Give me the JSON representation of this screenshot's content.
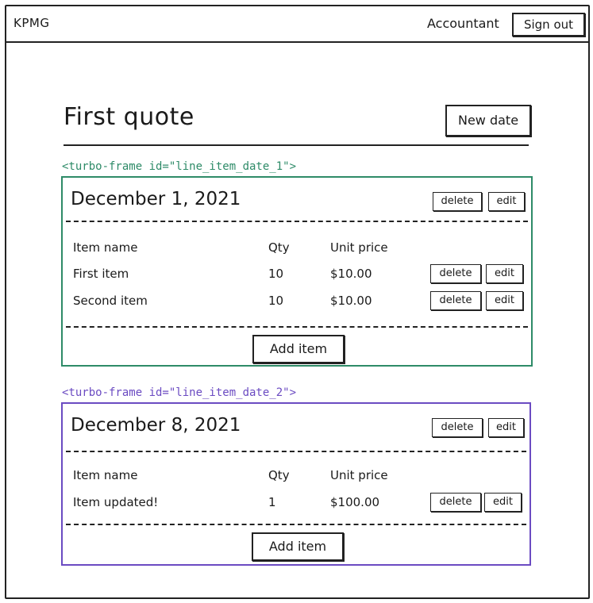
{
  "navbar": {
    "brand": "KPMG",
    "user": "Accountant",
    "sign_out": "Sign out"
  },
  "quote": {
    "title": "First quote",
    "new_date": "New date"
  },
  "frames": [
    {
      "label": "<turbo-frame id=\"line_item_date_1\">",
      "color": "#2e8b68",
      "date": "December 1, 2021",
      "delete": "delete",
      "edit": "edit",
      "headers": {
        "name": "Item name",
        "qty": "Qty",
        "price": "Unit price"
      },
      "items": [
        {
          "name": "First item",
          "qty": "10",
          "price": "$10.00",
          "delete": "delete",
          "edit": "edit"
        },
        {
          "name": "Second item",
          "qty": "10",
          "price": "$10.00",
          "delete": "delete",
          "edit": "edit"
        }
      ],
      "add_item": "Add item"
    },
    {
      "label": "<turbo-frame id=\"line_item_date_2\">",
      "color": "#6b4bc2",
      "date": "December 8, 2021",
      "delete": "delete",
      "edit": "edit",
      "headers": {
        "name": "Item name",
        "qty": "Qty",
        "price": "Unit price"
      },
      "items": [
        {
          "name": "Item updated!",
          "qty": "1",
          "price": "$100.00",
          "delete": "delete",
          "edit": "edit"
        }
      ],
      "add_item": "Add item"
    }
  ]
}
